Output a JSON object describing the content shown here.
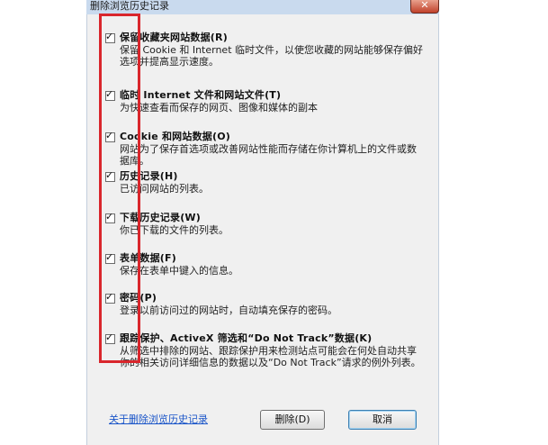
{
  "window": {
    "title": "删除浏览历史记录",
    "close_icon": "close-icon"
  },
  "options": [
    {
      "label": "保留收藏夹网站数据(R)",
      "checked": true,
      "desc": "保留 Cookie 和 Internet 临时文件，以使您收藏的网站能够保存偏好选项并提高显示速度。"
    },
    {
      "label": "临时 Internet 文件和网站文件(T)",
      "checked": true,
      "desc": "为快速查看而保存的网页、图像和媒体的副本"
    },
    {
      "label": "Cookie 和网站数据(O)",
      "checked": true,
      "desc": "网站为了保存首选项或改善网站性能而存储在你计算机上的文件或数据库。"
    },
    {
      "label": "历史记录(H)",
      "checked": true,
      "desc": "已访问网站的列表。"
    },
    {
      "label": "下载历史记录(W)",
      "checked": true,
      "desc": "你已下载的文件的列表。"
    },
    {
      "label": "表单数据(F)",
      "checked": true,
      "desc": "保存在表单中键入的信息。"
    },
    {
      "label": "密码(P)",
      "checked": true,
      "desc": "登录以前访问过的网站时，自动填充保存的密码。"
    },
    {
      "label": "跟踪保护、ActiveX 筛选和“Do Not Track”数据(K)",
      "checked": true,
      "desc": "从筛选中排除的网站、跟踪保护用来检测站点可能会在何处自动共享你的相关访问详细信息的数据以及“Do Not Track”请求的例外列表。"
    }
  ],
  "footer": {
    "link": "关于删除浏览历史记录",
    "delete_button": "删除(D)",
    "cancel_button": "取消"
  },
  "colors": {
    "highlight_box": "#d9262c",
    "link": "#1a55c8"
  }
}
